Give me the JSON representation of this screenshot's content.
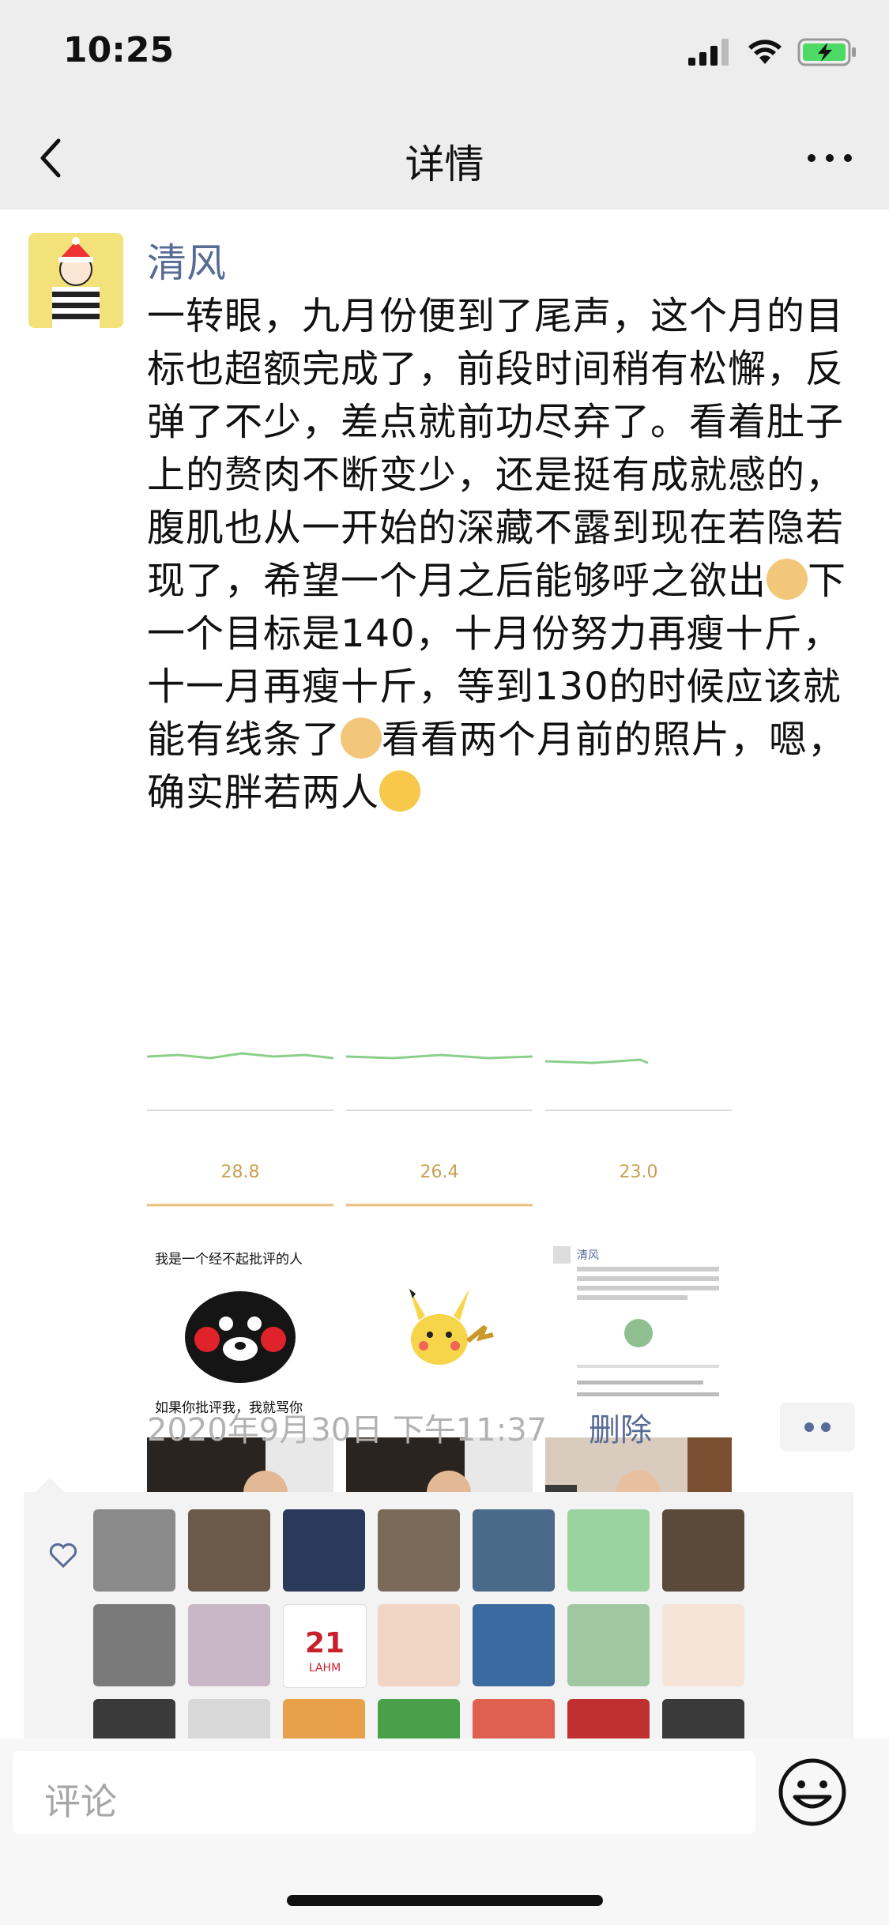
{
  "status_bar": {
    "time": "10:25"
  },
  "nav": {
    "title": "详情"
  },
  "post": {
    "username": "清风",
    "text_part1": "一转眼，九月份便到了尾声，这个月的目标也超额完成了，前段时间稍有松懈，反弹了不少，差点就前功尽弃了。看着肚子上的赘肉不断变少，还是挺有成就感的，腹肌也从一开始的深藏不露到现在若隐若现了，希望一个月之后能够呼之欲出",
    "text_part2": "下一个目标是140，十月份努力再瘦十斤，十一月再瘦十斤，等到130的时候应该就能有线条了",
    "text_part3": "看看两个月前的照片，嗯，确实胖若两人",
    "timestamp": "2020年9月30日 下午11:37",
    "delete_label": "删除",
    "images": [
      {
        "kind": "chart",
        "value": "28.8"
      },
      {
        "kind": "chart",
        "value": "26.4"
      },
      {
        "kind": "chart",
        "value": "23.0"
      },
      {
        "kind": "meme",
        "top_text": "我是一个经不起批评的人",
        "bottom_text": "如果你批评我，我就骂你"
      },
      {
        "kind": "pikachu"
      },
      {
        "kind": "screenshot",
        "header": "清风"
      },
      {
        "kind": "photo"
      },
      {
        "kind": "photo"
      },
      {
        "kind": "photo"
      }
    ]
  },
  "likes": {
    "avatar_colors": [
      "#8a8a8a",
      "#6b5a4a",
      "#2b3a5a",
      "#7a6a5a",
      "#4a6a8a",
      "#9ad2a0",
      "#5a4a3a",
      "#7a7a7a",
      "#c9b7c7",
      "#e03a3a",
      "#f0d4c4",
      "#3a6aa0",
      "#a0c8a0",
      "#f6e4d8",
      "#3a3a3a",
      "#d8d8d8",
      "#e8a04a",
      "#4aa04a",
      "#e06050",
      "#c03030",
      "#3a3a3a"
    ],
    "calendar_text": "21",
    "calendar_sub": "LAHM"
  },
  "comment": {
    "placeholder": "评论"
  }
}
